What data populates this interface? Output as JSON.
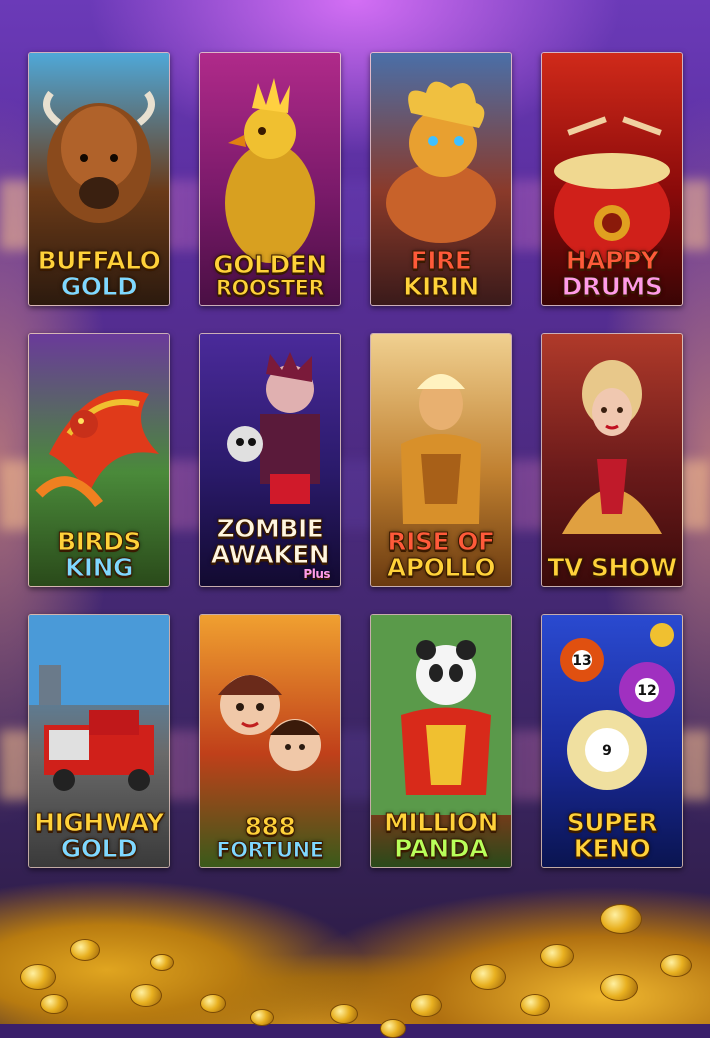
{
  "games": [
    {
      "id": "buffalo-gold",
      "line1": "BUFFALO",
      "line2": "GOLD",
      "c1": "gold",
      "c2": "blue",
      "bg": [
        "#4fa8d8",
        "#6a3a18",
        "#2c1a0e"
      ],
      "art": "buffalo"
    },
    {
      "id": "golden-rooster",
      "line1": "GOLDEN",
      "line2": "ROOSTER",
      "c1": "gold",
      "c2": "gold",
      "bg": [
        "#b02a8a",
        "#7a1a6a",
        "#4a0f44"
      ],
      "art": "rooster"
    },
    {
      "id": "fire-kirin",
      "line1": "FIRE",
      "line2": "KIRIN",
      "c1": "red",
      "c2": "gold",
      "bg": [
        "#4a6fa8",
        "#8a3a2a",
        "#3a1a1a"
      ],
      "art": "kirin"
    },
    {
      "id": "happy-drums",
      "line1": "HAPPY",
      "line2": "DRUMS",
      "c1": "red",
      "c2": "pink",
      "bg": [
        "#d02a1a",
        "#8a0a0a",
        "#3a0505"
      ],
      "art": "drum"
    },
    {
      "id": "birds-king",
      "line1": "BIRDS",
      "line2": "KING",
      "c1": "gold",
      "c2": "blue",
      "bg": [
        "#6a3a9a",
        "#4a8a3a",
        "#2a4a1a"
      ],
      "art": "bird"
    },
    {
      "id": "zombie-awaken",
      "line1": "ZOMBIE",
      "line2": "AWAKEN",
      "line3": "Plus",
      "c1": "white",
      "c2": "white",
      "bg": [
        "#4a2a9a",
        "#2a1a6a",
        "#120a30"
      ],
      "art": "zombie"
    },
    {
      "id": "rise-of-apollo",
      "line1": "RISE OF",
      "line2": "APOLLO",
      "c1": "red",
      "c2": "gold",
      "bg": [
        "#f0d090",
        "#c08030",
        "#6a3a10"
      ],
      "art": "apollo"
    },
    {
      "id": "tv-show",
      "line1": "TV SHOW",
      "line2": "",
      "c1": "gold",
      "c2": "gold",
      "bg": [
        "#b03a2a",
        "#6a1a1a",
        "#3a0a0a"
      ],
      "art": "tvshow"
    },
    {
      "id": "highway-gold",
      "line1": "HIGHWAY",
      "line2": "GOLD",
      "c1": "gold",
      "c2": "blue",
      "bg": [
        "#4a9ad8",
        "#6a6a6a",
        "#3a3a3a"
      ],
      "art": "truck"
    },
    {
      "id": "888-fortune",
      "line1": "888",
      "line2": "FORTUNE",
      "c1": "gold",
      "c2": "blue",
      "bg": [
        "#f0a030",
        "#c0401a",
        "#3a5a1a"
      ],
      "art": "kids"
    },
    {
      "id": "million-panda",
      "line1": "MILLION",
      "line2": "PANDA",
      "c1": "gold",
      "c2": "green",
      "bg": [
        "#5a9a4a",
        "#c82a1a",
        "#2a4a1a"
      ],
      "art": "panda"
    },
    {
      "id": "super-keno",
      "line1": "SUPER",
      "line2": "KENO",
      "c1": "gold",
      "c2": "gold",
      "bg": [
        "#2a4ad0",
        "#1a2a9a",
        "#0a1450"
      ],
      "art": "keno"
    }
  ]
}
